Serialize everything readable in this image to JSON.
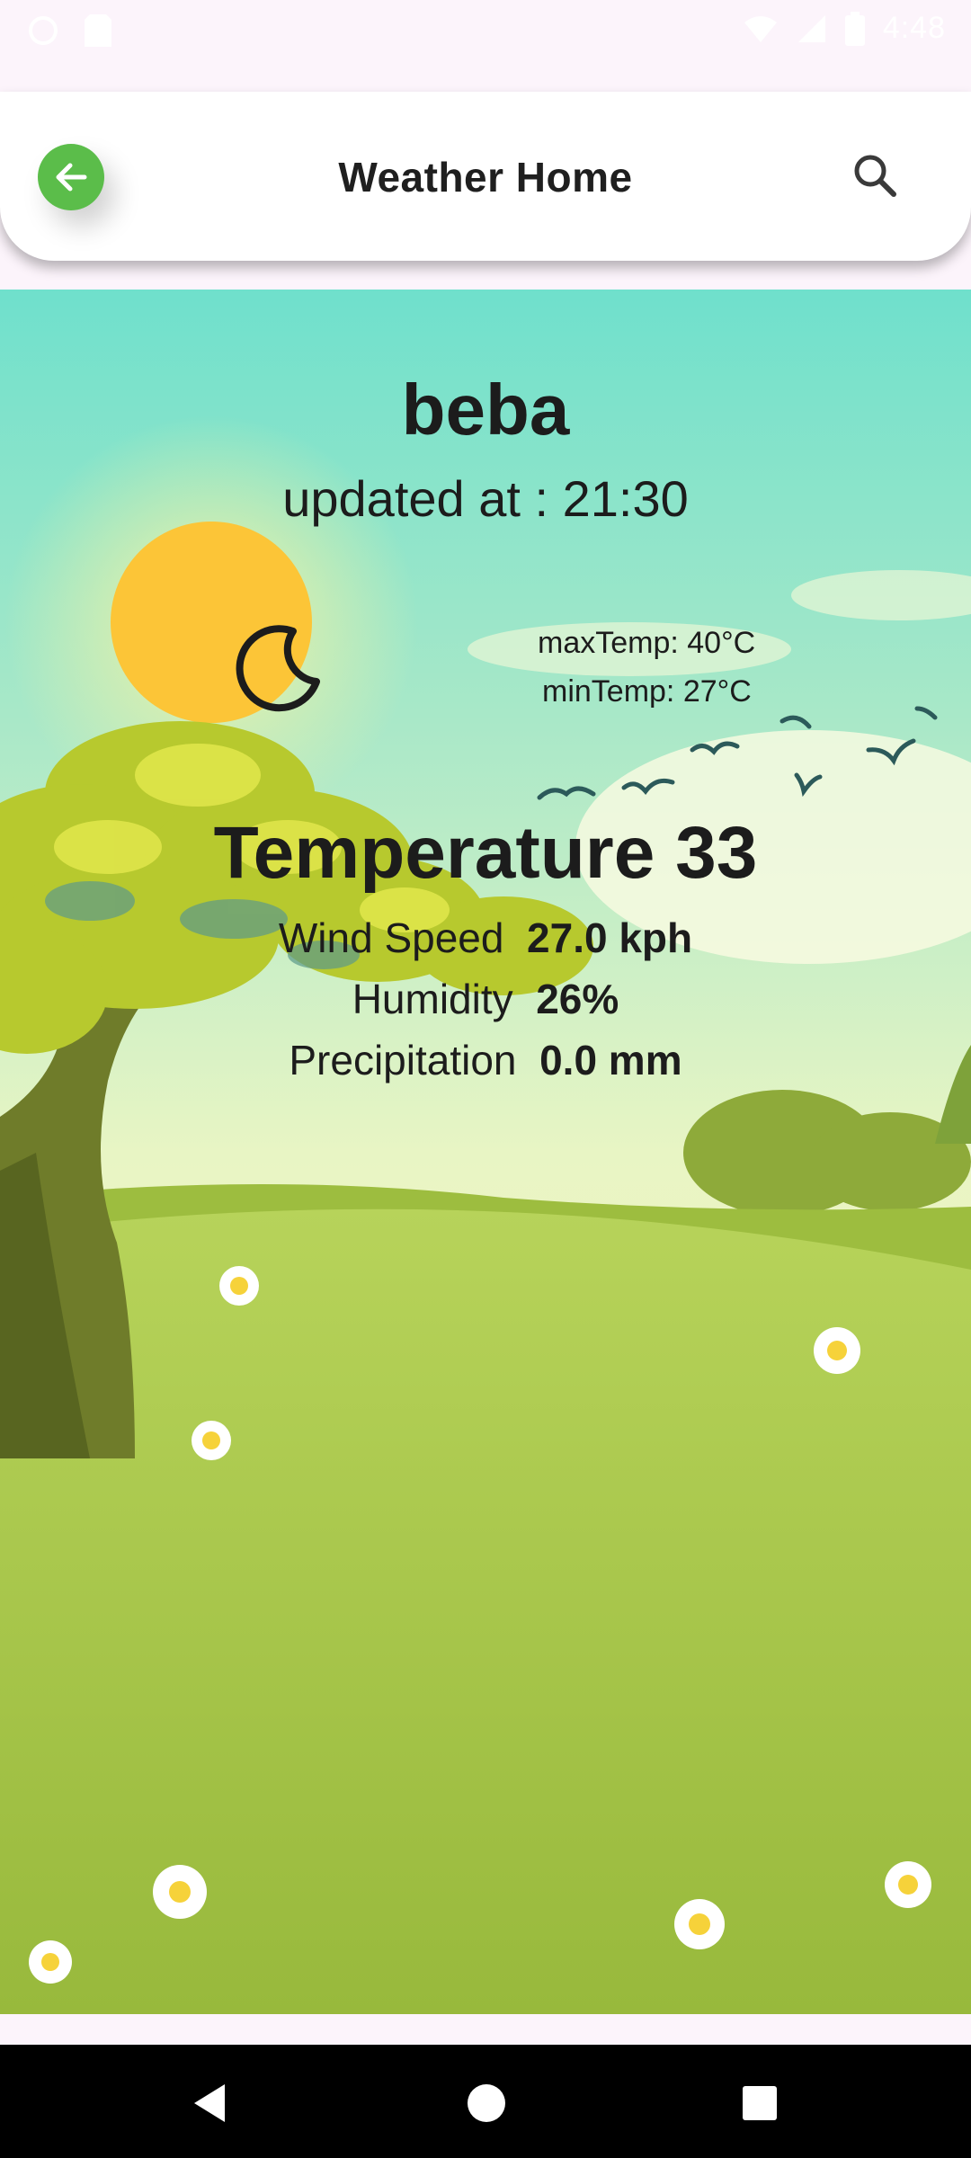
{
  "status_bar": {
    "time": "4:48"
  },
  "app_bar": {
    "title": "Weather Home"
  },
  "weather": {
    "city": "beba",
    "updated": "updated at : 21:30",
    "max_temp": "maxTemp: 40°C",
    "min_temp": "minTemp: 27°C",
    "temperature": "Temperature 33",
    "wind_label": "Wind Speed",
    "wind_value": "27.0 kph",
    "humidity_label": "Humidity",
    "humidity_value": "26%",
    "precip_label": "Precipitation",
    "precip_value": "0.0 mm",
    "condition_icon": "crescent-moon-icon"
  },
  "icons": {
    "back": "arrow-left-icon",
    "search": "search-icon",
    "nav_back": "triangle-back-icon",
    "nav_home": "circle-home-icon",
    "nav_recents": "square-recents-icon"
  },
  "colors": {
    "accent_green": "#5bbd4a",
    "sky_top": "#6fe0cc",
    "sun": "#fcc537",
    "grass": "#a6c448"
  }
}
